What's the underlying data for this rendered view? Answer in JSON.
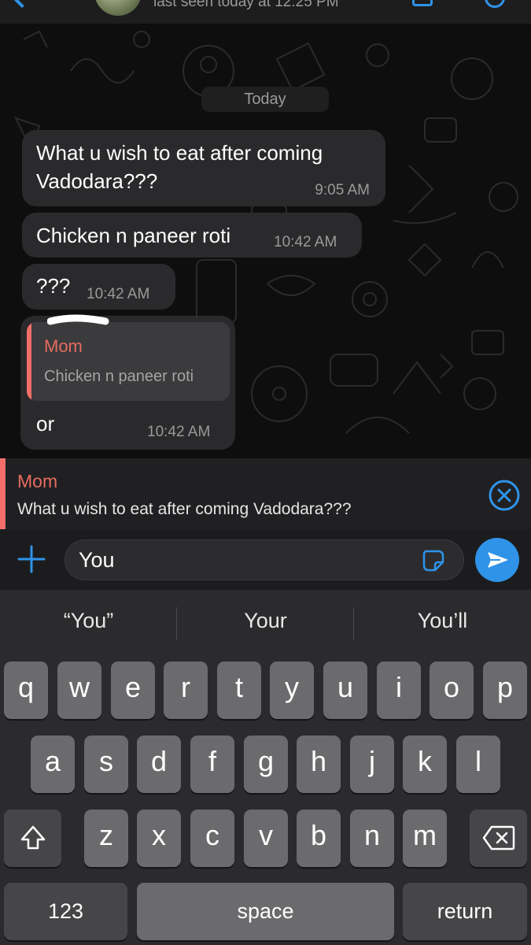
{
  "header": {
    "status": "last seen today at 12:25 PM"
  },
  "chat": {
    "date_separator": "Today",
    "messages": [
      {
        "text_lines": [
          "What u wish to eat after coming",
          "Vadodara???"
        ],
        "time": "9:05 AM"
      },
      {
        "text": "Chicken n paneer roti",
        "time": "10:42 AM"
      },
      {
        "text": "???",
        "time": "10:42 AM"
      },
      {
        "quote_author": "Mom",
        "quote_text": "Chicken n paneer roti",
        "text": "or",
        "time": "10:42 AM"
      }
    ]
  },
  "reply_preview": {
    "author": "Mom",
    "text": "What u wish to eat after coming Vadodara???"
  },
  "composer": {
    "value": "You"
  },
  "keyboard": {
    "suggestions": [
      "“You”",
      "Your",
      "You’ll"
    ],
    "row1": [
      "q",
      "w",
      "e",
      "r",
      "t",
      "y",
      "u",
      "i",
      "o",
      "p"
    ],
    "row2": [
      "a",
      "s",
      "d",
      "f",
      "g",
      "h",
      "j",
      "k",
      "l"
    ],
    "row3": [
      "z",
      "x",
      "c",
      "v",
      "b",
      "n",
      "m"
    ],
    "numbers_label": "123",
    "space_label": "space",
    "return_label": "return"
  },
  "colors": {
    "accent": "#2f93e8",
    "reply_bar": "#f56f6a",
    "bubble": "#2a2a2c"
  }
}
